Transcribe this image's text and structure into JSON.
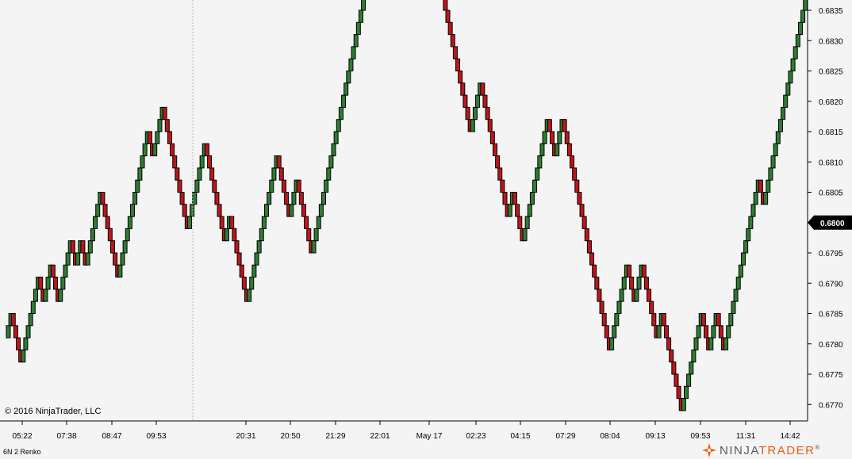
{
  "copyright": "© 2016 NinjaTrader, LLC",
  "instrument_label": "6N 2 Renko",
  "brand": {
    "part1": "NINJA",
    "part2": "TRADER",
    "mark": "®"
  },
  "colors": {
    "up": "#2e7d32",
    "down": "#c0141b",
    "background": "#f4f4f4"
  },
  "chart_data": {
    "type": "renko",
    "brick_size": 0.0002,
    "start": 0.6781,
    "moves": [
      1,
      1,
      -1,
      -1,
      -1,
      -1,
      1,
      1,
      1,
      1,
      1,
      1,
      1,
      -1,
      -1,
      1,
      1,
      1,
      -1,
      -1,
      -1,
      1,
      1,
      1,
      1,
      1,
      -1,
      -1,
      1,
      1,
      -1,
      -1,
      1,
      1,
      1,
      1,
      1,
      1,
      -1,
      -1,
      -1,
      -1,
      -1,
      -1,
      -1,
      1,
      1,
      1,
      1,
      1,
      1,
      1,
      1,
      1,
      1,
      1,
      1,
      -1,
      -1,
      1,
      1,
      1,
      1,
      -1,
      -1,
      -1,
      -1,
      -1,
      -1,
      -1,
      -1,
      -1,
      -1,
      1,
      1,
      1,
      1,
      1,
      1,
      1,
      -1,
      -1,
      -1,
      -1,
      -1,
      -1,
      -1,
      -1,
      1,
      1,
      -1,
      -1,
      -1,
      -1,
      -1,
      -1,
      -1,
      1,
      1,
      1,
      1,
      1,
      1,
      1,
      1,
      1,
      1,
      1,
      1,
      -1,
      -1,
      -1,
      -1,
      -1,
      1,
      1,
      1,
      -1,
      -1,
      -1,
      -1,
      -1,
      -1,
      1,
      1,
      1,
      1,
      1,
      1,
      1,
      1,
      1,
      1,
      1,
      1,
      1,
      1,
      1,
      1,
      1,
      1,
      1,
      1,
      1,
      1,
      1,
      1,
      1,
      -1,
      -1,
      -1,
      -1,
      1,
      1,
      -1,
      -1,
      1,
      1,
      1,
      1,
      1,
      1,
      1,
      1,
      1,
      1,
      -1,
      -1,
      -1,
      -1,
      -1,
      -1,
      -1,
      -1,
      -1,
      -1,
      -1,
      -1,
      -1,
      -1,
      -1,
      -1,
      -1,
      -1,
      -1,
      -1,
      -1,
      1,
      1,
      1,
      1,
      -1,
      -1,
      -1,
      -1,
      -1,
      -1,
      -1,
      -1,
      -1,
      -1,
      -1,
      1,
      1,
      -1,
      -1,
      -1,
      -1,
      1,
      1,
      1,
      1,
      1,
      1,
      1,
      1,
      1,
      1,
      -1,
      -1,
      -1,
      1,
      1,
      1,
      -1,
      -1,
      -1,
      -1,
      -1,
      -1,
      -1,
      -1,
      -1,
      -1,
      -1,
      -1,
      -1,
      -1,
      -1,
      -1,
      -1,
      -1,
      -1,
      1,
      1,
      1,
      1,
      1,
      1,
      1,
      -1,
      -1,
      -1,
      1,
      1,
      1,
      -1,
      -1,
      -1,
      -1,
      -1,
      -1,
      1,
      1,
      -1,
      -1,
      -1,
      -1,
      -1,
      -1,
      -1,
      -1,
      1,
      1,
      1,
      1,
      1,
      1,
      1,
      1,
      -1,
      -1,
      -1,
      1,
      1,
      1,
      -1,
      -1,
      -1,
      1,
      1,
      1,
      1,
      1,
      1,
      1,
      1,
      1,
      1,
      1,
      1,
      1,
      1,
      -1,
      -1,
      1,
      1,
      1,
      1,
      1,
      1,
      1,
      1,
      1,
      1,
      1,
      1,
      1,
      1,
      1,
      1,
      1,
      1,
      1,
      1,
      1,
      1,
      1,
      1,
      -1,
      -1,
      -1,
      -1,
      -1,
      -1,
      1,
      1,
      1,
      1,
      1,
      1,
      -1,
      -1,
      -1,
      -1,
      -1,
      -1,
      -1,
      -1,
      -1,
      -1,
      -1,
      -1,
      -1,
      -1,
      -1,
      -1,
      -1,
      -1,
      -1,
      -1,
      -1,
      -1,
      -1,
      -1,
      -1,
      -1,
      1,
      1,
      -1,
      1
    ],
    "x_labels": [
      "05:22",
      "07:38",
      "08:47",
      "09:53",
      "20:31",
      "20:50",
      "21:29",
      "22:01",
      "May 17",
      "02:23",
      "04:15",
      "07:29",
      "08:04",
      "09:13",
      "09:53",
      "11:31",
      "14:42"
    ],
    "y_ticks": [
      "0.6835",
      "0.6830",
      "0.6825",
      "0.6820",
      "0.6815",
      "0.6810",
      "0.6805",
      "0.6800",
      "0.6795",
      "0.6790",
      "0.6785",
      "0.6780",
      "0.6775",
      "0.6770"
    ],
    "ylim": [
      0.67675,
      0.68365
    ],
    "last_price": "0.6800",
    "session_break_after_label": "09:53"
  }
}
